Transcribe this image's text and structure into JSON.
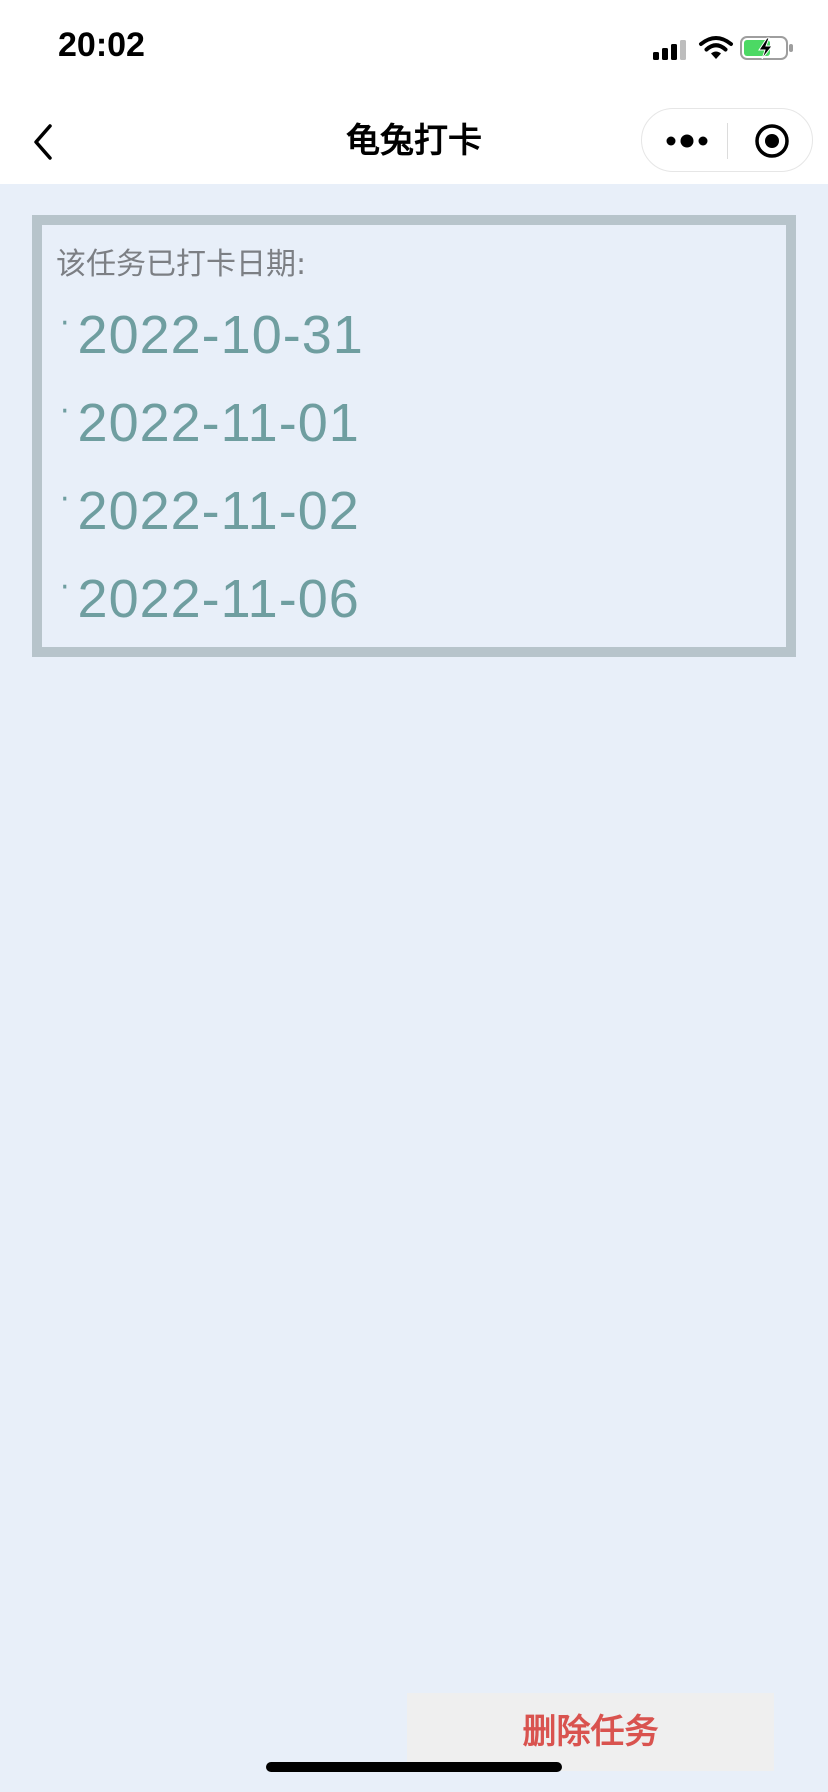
{
  "status_bar": {
    "time": "20:02",
    "icons": [
      "signal-icon",
      "wifi-icon",
      "battery-charging-icon"
    ],
    "battery_color": "#4cd964"
  },
  "nav": {
    "title": "龟兔打卡",
    "icons": [
      "back-icon",
      "more-icon",
      "close-icon"
    ]
  },
  "card": {
    "title": "该任务已打卡日期:",
    "bullet": "·",
    "dates": [
      "2022-10-31",
      "2022-11-01",
      "2022-11-02",
      "2022-11-06"
    ],
    "border_color": "#b7c4cb",
    "date_color": "#6f9ea0"
  },
  "actions": {
    "delete_label": "删除任务",
    "delete_color": "#d9534f"
  },
  "colors": {
    "page_background": "#e8eff9",
    "header_background": "#ffffff"
  }
}
